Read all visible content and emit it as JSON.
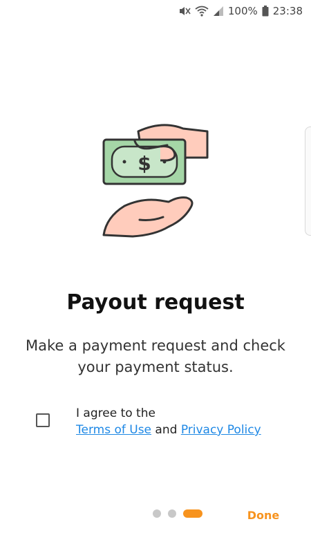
{
  "status_bar": {
    "battery": "100%",
    "time": "23:38",
    "icons": [
      "mute-icon",
      "wifi-icon",
      "signal-icon",
      "battery-icon"
    ]
  },
  "onboarding": {
    "illustration": "money-exchange-illustration",
    "title": "Payout request",
    "subtitle": "Make a payment request and check your payment status.",
    "agree": {
      "checked": false,
      "prefix": "I agree to the",
      "terms_label": "Terms of Use",
      "conjunction": "and",
      "privacy_label": "Privacy Policy"
    },
    "pager": {
      "count": 3,
      "active_index": 2
    },
    "done_label": "Done"
  },
  "colors": {
    "accent": "#f7931e",
    "link": "#1e88e5",
    "money": "#a5d6a7",
    "hand": "#ffccbc"
  }
}
